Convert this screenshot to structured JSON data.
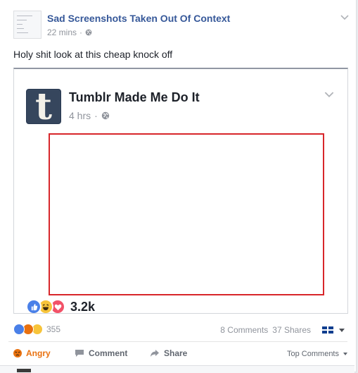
{
  "post": {
    "page_name": "Sad Screenshots Taken Out Of Context",
    "time": "22 mins",
    "meta_separator": "·",
    "text": "Holy shit look at this cheap knock off"
  },
  "embedded": {
    "page_name": "Tumblr Made Me Do It",
    "logo_letter": "t",
    "time": "4 hrs",
    "meta_separator": "·",
    "reaction_count": "3.2k",
    "reactions": [
      "like-icon",
      "haha-icon",
      "love-icon"
    ]
  },
  "summary": {
    "reaction_count": "355",
    "reactions": [
      "like-icon",
      "angry-icon",
      "sad-icon"
    ],
    "comments": "8 Comments",
    "shares": "37 Shares"
  },
  "actions": {
    "react_label": "Angry",
    "comment_label": "Comment",
    "share_label": "Share",
    "sort_label": "Top Comments"
  },
  "colors": {
    "link": "#365899",
    "angry": "#e9710f",
    "highlight_box": "#d8262b",
    "tumblr_blue": "#36465d"
  }
}
